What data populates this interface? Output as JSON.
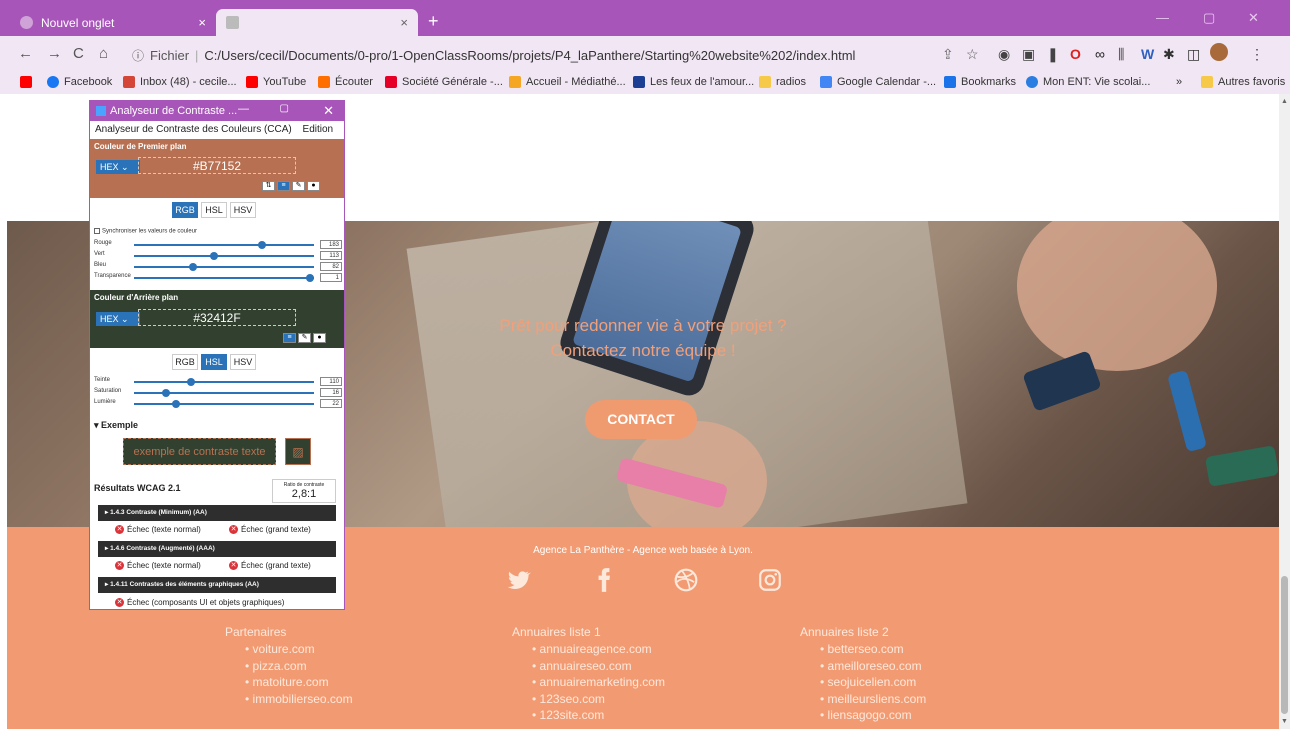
{
  "browser": {
    "tabs": [
      {
        "label": "Nouvel onglet",
        "close": "×"
      },
      {
        "label": "",
        "close": "×"
      }
    ],
    "new_tab": "+",
    "window_controls": {
      "minimize": "—",
      "maximize": "▢",
      "close": "✕"
    },
    "nav": {
      "back": "←",
      "forward": "→",
      "reload": "C",
      "home": "⌂"
    },
    "address_prefix": "Fichier",
    "address": "C:/Users/cecil/Documents/0-pro/1-OpenClassRooms/projets/P4_laPanthere/Starting%20website%202/index.html",
    "bookmarks": [
      {
        "label": "Facebook",
        "color": "#1877f2"
      },
      {
        "label": "Inbox (48) - cecile...",
        "color": "#d44638"
      },
      {
        "label": "YouTube",
        "color": "#ff0000"
      },
      {
        "label": "Écouter",
        "color": "#ff6f00"
      },
      {
        "label": "Société Générale -...",
        "color": "#e60028"
      },
      {
        "label": "Accueil - Médiathé...",
        "color": "#f5a623"
      },
      {
        "label": "Les feux de l'amour...",
        "color": "#1c3f94"
      },
      {
        "label": "radios",
        "color": "#f7c948"
      },
      {
        "label": "Google Calendar -...",
        "color": "#4285f4"
      },
      {
        "label": "Bookmarks",
        "color": "#1a73e8"
      },
      {
        "label": "Mon ENT: Vie scolai...",
        "color": "#2a7de1"
      }
    ],
    "bookmarks_overflow": "»",
    "other_bookmarks": "Autres favoris"
  },
  "cca": {
    "window_title": "Analyseur de Contraste ...",
    "menu": [
      "Analyseur de Contraste des Couleurs (CCA)",
      "Edition"
    ],
    "foreground": {
      "title": "Couleur de Premier plan",
      "format": "HEX",
      "value": "#B77152",
      "tabs": [
        "RGB",
        "HSL",
        "HSV"
      ],
      "active_tab": "RGB",
      "sync_label": "Synchroniser les valeurs de couleur",
      "sliders": [
        {
          "label": "Rouge",
          "value": "183",
          "level": 0.72
        },
        {
          "label": "Vert",
          "value": "113",
          "level": 0.44
        },
        {
          "label": "Bleu",
          "value": "82",
          "level": 0.32
        },
        {
          "label": "Transparence",
          "value": "1",
          "level": 1.0
        }
      ]
    },
    "background": {
      "title": "Couleur d'Arrière plan",
      "format": "HEX",
      "value": "#32412F",
      "tabs": [
        "RGB",
        "HSL",
        "HSV"
      ],
      "active_tab": "HSL",
      "sliders": [
        {
          "label": "Teinte",
          "value": "110",
          "level": 0.31
        },
        {
          "label": "Saturation",
          "value": "16",
          "level": 0.16
        },
        {
          "label": "Lumière",
          "value": "22",
          "level": 0.22
        }
      ]
    },
    "example": {
      "title": "▾ Exemple",
      "text": "exemple de contraste texte"
    },
    "results": {
      "title": "Résultats WCAG 2.1",
      "ratio_label": "Ratio de contraste",
      "ratio_value": "2,8:1",
      "criteria": [
        {
          "title": "▸ 1.4.3 Contraste (Minimum) (AA)",
          "items": [
            "Échec (texte normal)",
            "Échec (grand texte)"
          ]
        },
        {
          "title": "▸ 1.4.6 Contraste (Augmenté) (AAA)",
          "items": [
            "Échec (texte normal)",
            "Échec (grand texte)"
          ]
        },
        {
          "title": "▸ 1.4.11 Contrastes des éléments graphiques (AA)",
          "items": [
            "Échec (composants UI et objets graphiques)"
          ]
        }
      ]
    }
  },
  "site": {
    "hero_line1": "Prêt pour redonner vie à votre projet ?",
    "hero_line2": "Contactez notre équipe !",
    "cta": "CONTACT",
    "agency": "Agence La Panthère - Agence web basée à Lyon.",
    "columns": [
      {
        "title": "Partenaires",
        "links": [
          "voiture.com",
          "pizza.com",
          "matoiture.com",
          "immobilierseo.com"
        ]
      },
      {
        "title": "Annuaires liste 1",
        "links": [
          "annuaireagence.com",
          "annuaireseo.com",
          "annuairemarketing.com",
          "123seo.com",
          "123site.com"
        ]
      },
      {
        "title": "Annuaires liste 2",
        "links": [
          "betterseo.com",
          "ameilloreseo.com",
          "seojuicelien.com",
          "meilleursliens.com",
          "liensagogo.com"
        ]
      }
    ],
    "colors": {
      "accent": "#f29b72",
      "cta": "#f09a70",
      "hero_text": "#f0a07a"
    }
  }
}
